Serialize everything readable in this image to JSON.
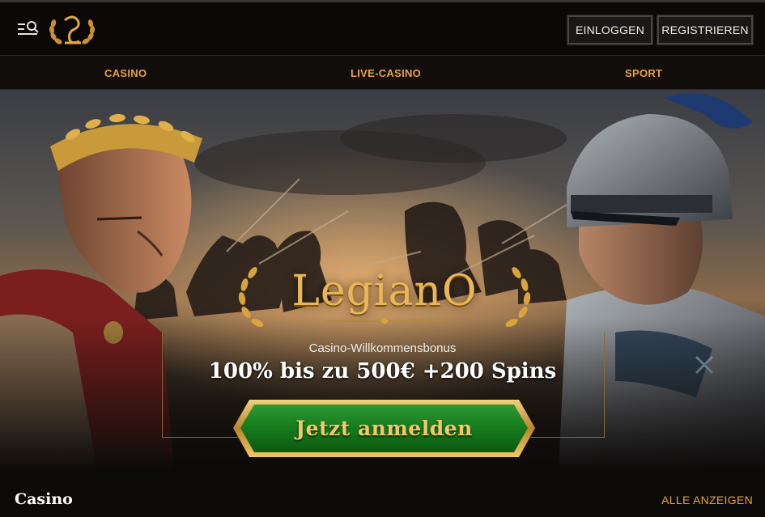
{
  "header": {
    "login_label": "EINLOGGEN",
    "register_label": "REGISTRIEREN",
    "menu_icon": "menu-search-icon",
    "logo_icon": "legiano-laurel-logo"
  },
  "nav": {
    "items": [
      {
        "label": "CASINO"
      },
      {
        "label": "LIVE-CASINO"
      },
      {
        "label": "SPORT"
      }
    ]
  },
  "hero": {
    "brand": "LegianO",
    "bonus_subtitle": "Casino-Willkommensbonus",
    "bonus_title": "100% bis zu 500€ +200 Spins",
    "cta_label": "Jetzt anmelden"
  },
  "section": {
    "title": "Casino",
    "view_all_label": "ALLE ANZEIGEN"
  },
  "colors": {
    "accent_gold": "#e7a437",
    "cta_green": "#1f7a22",
    "background": "#0d0b0a"
  }
}
